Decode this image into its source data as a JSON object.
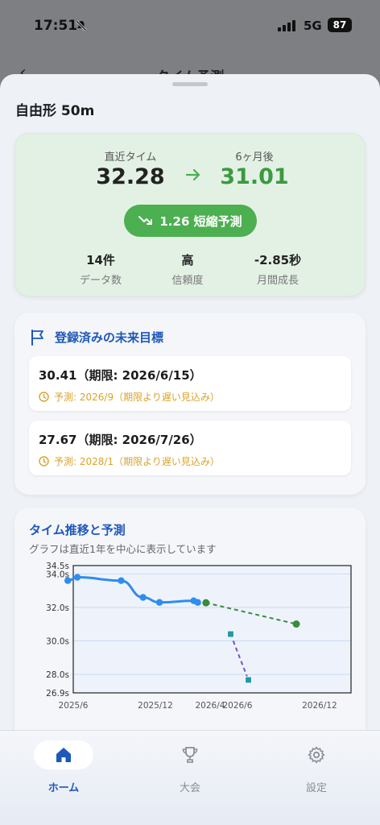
{
  "status": {
    "time": "17:51",
    "network": "5G",
    "battery": "87"
  },
  "behind": {
    "title": "タイム予測"
  },
  "event": {
    "title": "自由形 50m"
  },
  "summary": {
    "recent_label": "直近タイム",
    "recent_value": "32.28",
    "future_label": "6ヶ月後",
    "future_value": "31.01",
    "badge": "1.26 短縮予測",
    "stats": [
      {
        "value": "14件",
        "label": "データ数"
      },
      {
        "value": "高",
        "label": "信頼度"
      },
      {
        "value": "-2.85秒",
        "label": "月間成長"
      }
    ],
    "colors": {
      "accent": "#4caf50",
      "future": "#3a9a3f"
    }
  },
  "goals": {
    "title": "登録済みの未来目標",
    "items": [
      {
        "main": "30.41（期限: 2026/6/15）",
        "sub": "予測: 2026/9（期限より遅い見込み）"
      },
      {
        "main": "27.67（期限: 2026/7/26）",
        "sub": "予測: 2028/1（期限より遅い見込み）"
      }
    ]
  },
  "chart": {
    "title": "タイム推移と予測",
    "subtitle": "グラフは直近1年を中心に表示しています"
  },
  "chart_data": {
    "type": "line",
    "y_ticks": [
      "34.5s",
      "34.0s",
      "32.0s",
      "30.0s",
      "28.0s",
      "26.9s"
    ],
    "y_tick_values": [
      34.5,
      34.0,
      32.0,
      30.0,
      28.0,
      26.9
    ],
    "x_ticks": [
      "2025/6",
      "2025/12",
      "2026/4",
      "2026/6",
      "2026/12"
    ],
    "x_tick_months": [
      0,
      6,
      10,
      12,
      18
    ],
    "xlim_months": [
      0,
      20.3
    ],
    "ylim": [
      26.9,
      34.5
    ],
    "grid": true,
    "series": [
      {
        "style": "actual",
        "color": "#2f8ded",
        "points": [
          [
            -0.4,
            33.6
          ],
          [
            0.3,
            33.8
          ],
          [
            3.5,
            33.6
          ],
          [
            5.1,
            32.6
          ],
          [
            6.3,
            32.3
          ],
          [
            8.8,
            32.4
          ],
          [
            9.1,
            32.3
          ]
        ]
      },
      {
        "style": "forecast",
        "color": "#3a8a3e",
        "points": [
          [
            9.7,
            32.28
          ],
          [
            16.3,
            31.01
          ]
        ]
      },
      {
        "style": "goal-projection",
        "color": "#7a4fc4",
        "points": [
          [
            11.5,
            30.41
          ],
          [
            12.8,
            27.67
          ]
        ]
      }
    ]
  },
  "tabs": [
    {
      "label": "ホーム",
      "icon": "home-icon",
      "active": true
    },
    {
      "label": "大会",
      "icon": "trophy-icon",
      "active": false
    },
    {
      "label": "設定",
      "icon": "gear-icon",
      "active": false
    }
  ]
}
